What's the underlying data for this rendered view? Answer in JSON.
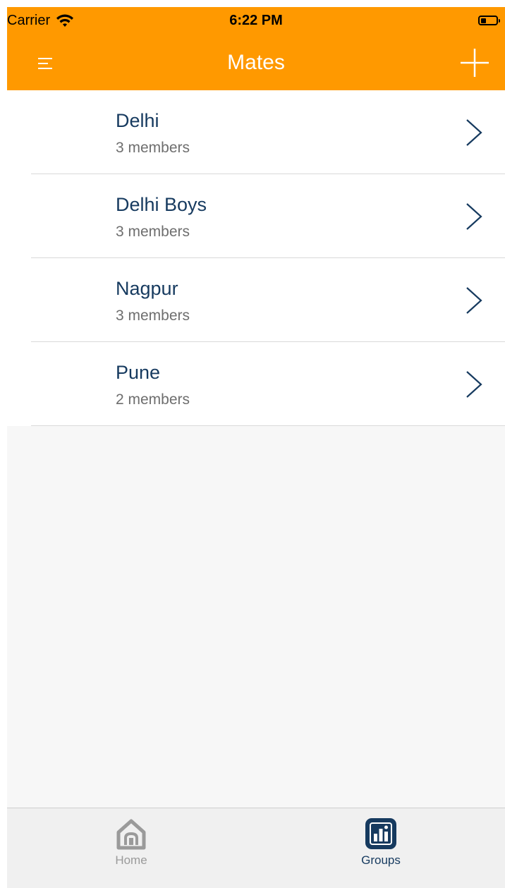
{
  "status_bar": {
    "carrier": "Carrier",
    "time": "6:22 PM",
    "battery_level": 0.35
  },
  "nav": {
    "title": "Mates",
    "menu_icon": "menu-icon",
    "add_icon": "plus-icon"
  },
  "groups": [
    {
      "name": "Delhi",
      "members": "3 members"
    },
    {
      "name": "Delhi Boys",
      "members": "3 members"
    },
    {
      "name": "Nagpur",
      "members": "3 members"
    },
    {
      "name": "Pune",
      "members": "2 members"
    }
  ],
  "tabs": [
    {
      "label": "Home",
      "icon": "home-icon",
      "selected": false
    },
    {
      "label": "Groups",
      "icon": "groups-chart-icon",
      "selected": true
    }
  ],
  "colors": {
    "accent": "#ff9900",
    "title_text": "#163a5f",
    "subtitle_text": "#6e6e6e",
    "inactive_tab": "#9a9a9a"
  }
}
